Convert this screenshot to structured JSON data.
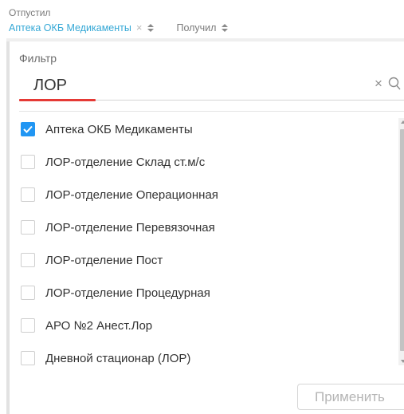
{
  "header": {
    "issued_label": "Отпустил",
    "issued_value": "Аптека ОКБ Медикаменты",
    "clear_glyph": "×",
    "received_label": "Получил"
  },
  "filter": {
    "label": "Фильтр",
    "value": "ЛОР",
    "clear_glyph": "×",
    "search_icon": "search-icon"
  },
  "options": [
    {
      "label": "Аптека ОКБ Медикаменты",
      "checked": true
    },
    {
      "label": "ЛОР-отделение Склад ст.м/с",
      "checked": false
    },
    {
      "label": "ЛОР-отделение Операционная",
      "checked": false
    },
    {
      "label": "ЛОР-отделение Перевязочная",
      "checked": false
    },
    {
      "label": "ЛОР-отделение Пост",
      "checked": false
    },
    {
      "label": "ЛОР-отделение Процедурная",
      "checked": false
    },
    {
      "label": "АРО №2 Анест.Лор",
      "checked": false
    },
    {
      "label": "Дневной стационар (ЛОР)",
      "checked": false
    }
  ],
  "apply_button": {
    "label": "Применить",
    "disabled": true
  },
  "colors": {
    "accent": "#35a8d6",
    "checkbox_checked": "#2196f3",
    "input_underline_active": "#e53935"
  }
}
